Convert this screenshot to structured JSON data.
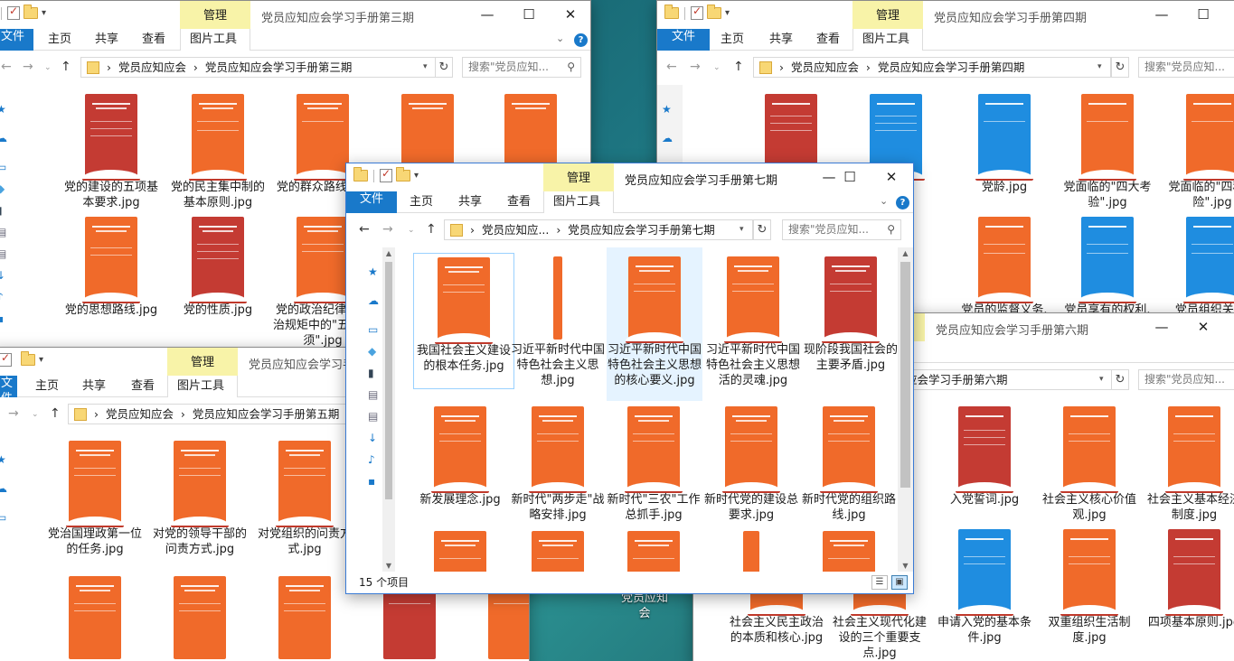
{
  "common": {
    "manage": "管理",
    "tab_file": "文件",
    "tab_home": "主页",
    "tab_share": "共享",
    "tab_view": "查看",
    "tab_picture_tools": "图片工具",
    "root_crumb": "党员应知应会",
    "root_crumb_short": "党员应知应...",
    "help": "?",
    "minimize": "—",
    "maximize": "☐",
    "close": "✕"
  },
  "win3": {
    "title": "党员应知应会学习手册第三期",
    "crumb": "党员应知应会学习手册第三期",
    "search_placeholder": "搜索\"党员应知...",
    "files": [
      "党的建设的五项基本要求.jpg",
      "党的民主集中制的基本原则.jpg",
      "党的群众路线.jpg",
      "党的思想路线.jpg",
      "党的性质.jpg",
      "党的政治纪律和政治规矩中的\"五个必须\".jpg"
    ]
  },
  "win4": {
    "title": "党员应知应会学习手册第四期",
    "crumb": "党员应知应会学习手册第四期",
    "search_placeholder": "搜索\"党员应知...",
    "files": [
      "党龄.jpg",
      "党面临的\"四大考验\".jpg",
      "党面临的\"四种危险\".jpg",
      "党员的监督义务.",
      "党员享有的权利.",
      "党员组织关系."
    ]
  },
  "win5": {
    "title": "党员应知应会学习手册第五期",
    "crumb": "党员应知应会学习手册第五期",
    "files": [
      "党治国理政第一位的任务.jpg",
      "对党的领导干部的问责方式.jpg",
      "对党组织的问责方式.jpg"
    ]
  },
  "win6": {
    "title": "党员应知应会学习手册第六期",
    "crumb": "党员应知应会学习手册第六期",
    "search_placeholder": "搜索\"党员应知...",
    "files": [
      "入党誓词.jpg",
      "社会主义核心价值观.jpg",
      "社会主义基本经济制度.jpg",
      "社会主义民主政治的本质和核心.jpg",
      "社会主义现代化建设的三个重要支点.jpg",
      "申请入党的基本条件.jpg",
      "双重组织生活制度.jpg",
      "四项基本原则.jpg"
    ]
  },
  "win7": {
    "title": "党员应知应会学习手册第七期",
    "crumb": "党员应知应会学习手册第七期",
    "search_placeholder": "搜索\"党员应知...",
    "status": "15 个项目",
    "files": [
      "我国社会主义建设的根本任务.jpg",
      "习近平新时代中国特色社会主义思想.jpg",
      "习近平新时代中国特色社会主义思想的核心要义.jpg",
      "习近平新时代中国特色社会主义思想活的灵魂.jpg",
      "现阶段我国社会的主要矛盾.jpg",
      "新发展理念.jpg",
      "新时代\"两步走\"战略安排.jpg",
      "新时代\"三农\"工作总抓手.jpg",
      "新时代党的建设总要求.jpg",
      "新时代党的组织路线.jpg"
    ]
  },
  "desktop": {
    "icon_label": "党员应知\n会"
  }
}
